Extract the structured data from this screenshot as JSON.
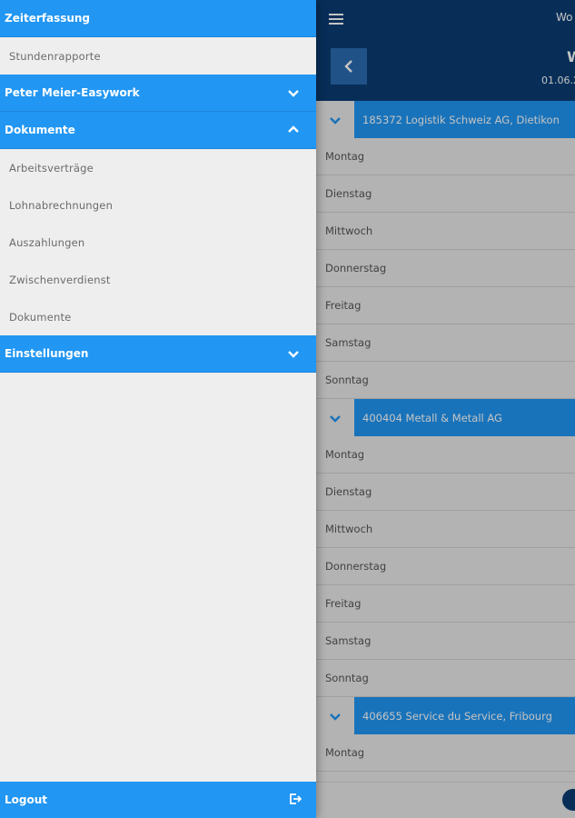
{
  "drawer": {
    "sections": [
      {
        "title": "Zeiterfassung",
        "icon": "",
        "items": [
          {
            "label": "Stundenrapporte"
          }
        ]
      },
      {
        "title": "Peter Meier-Easywork",
        "icon": "chevron-down-icon",
        "items": []
      },
      {
        "title": "Dokumente",
        "icon": "chevron-up-icon",
        "items": [
          {
            "label": "Arbeitsverträge"
          },
          {
            "label": "Lohnabrechnungen"
          },
          {
            "label": "Auszahlungen"
          },
          {
            "label": "Zwischenverdienst"
          },
          {
            "label": "Dokumente"
          }
        ]
      },
      {
        "title": "Einstellungen",
        "icon": "chevron-down-icon",
        "items": []
      }
    ],
    "logout_label": "Logout",
    "logout_icon": "logout-icon"
  },
  "main": {
    "header_title": "Wo",
    "sub_title": "W",
    "sub_date": "01.06.2",
    "groups": [
      {
        "label": "185372 Logistik Schweiz AG, Dietikon",
        "days": [
          "Montag",
          "Dienstag",
          "Mittwoch",
          "Donnerstag",
          "Freitag",
          "Samstag",
          "Sonntag"
        ]
      },
      {
        "label": "400404 Metall & Metall AG",
        "days": [
          "Montag",
          "Dienstag",
          "Mittwoch",
          "Donnerstag",
          "Freitag",
          "Samstag",
          "Sonntag"
        ]
      },
      {
        "label": "406655 Service du Service, Fribourg",
        "days": [
          "Montag"
        ]
      }
    ]
  },
  "colors": {
    "accent": "#2196f3",
    "navy": "#0b3d73",
    "drawer_bg": "#eeeeee",
    "main_bg": "#e9e9e9"
  }
}
